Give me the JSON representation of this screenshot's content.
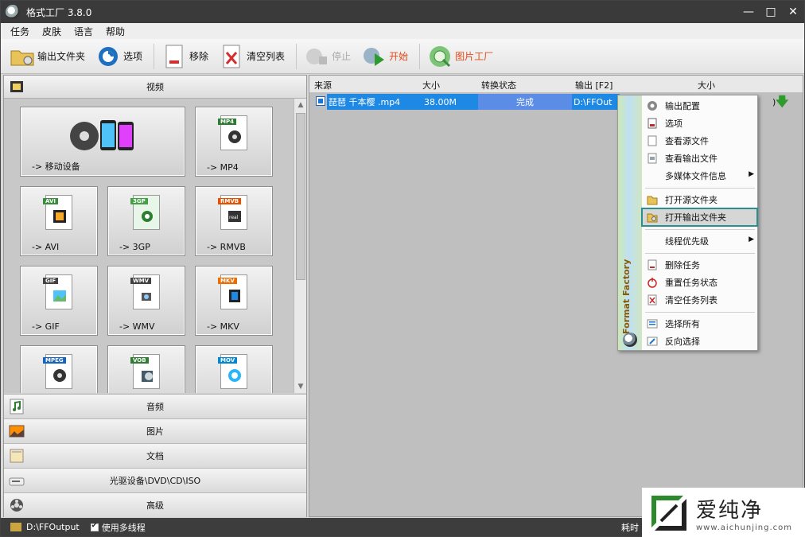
{
  "window": {
    "title": "格式工厂 3.8.0"
  },
  "menu": [
    "任务",
    "皮肤",
    "语言",
    "帮助"
  ],
  "toolbar": {
    "output_folder": "输出文件夹",
    "options": "选项",
    "remove": "移除",
    "clear_list": "清空列表",
    "stop": "停止",
    "start": "开始",
    "picture_factory": "图片工厂"
  },
  "left": {
    "video_header": "视频",
    "tiles": [
      "-> 移动设备",
      "-> MP4",
      "-> AVI",
      "-> 3GP",
      "-> RMVB",
      "-> GIF",
      "-> WMV",
      "-> MKV"
    ],
    "format_tags": [
      "MP4",
      "AVI",
      "3GP",
      "RMVB",
      "GIF",
      "WMV",
      "MKV",
      "MPEG",
      "VOB",
      "MOV"
    ],
    "categories": [
      "音频",
      "图片",
      "文档",
      "光驱设备\\DVD\\CD\\ISO",
      "高级"
    ]
  },
  "table": {
    "columns": [
      "来源",
      "大小",
      "转换状态",
      "输出 [F2]",
      "大小"
    ],
    "row": {
      "source": "琵琶 千本樱 .mp4",
      "size": "38.00M",
      "status": "完成",
      "output": "D:\\FFOut",
      "output_size_fragment": ")"
    }
  },
  "context_menu": {
    "brand": "Format Factory",
    "items": [
      "输出配置",
      "选项",
      "查看源文件",
      "查看输出文件",
      "多媒体文件信息",
      "打开源文件夹",
      "打开输出文件夹",
      "线程优先级",
      "删除任务",
      "重置任务状态",
      "清空任务列表",
      "选择所有",
      "反向选择"
    ]
  },
  "status": {
    "path": "D:\\FFOutput",
    "multithread": "使用多线程",
    "elapsed_label": "耗时"
  },
  "watermark": {
    "title": "爱纯净",
    "url": "www.aichunjing.com"
  },
  "colors": {
    "titlebar": "#3a3a3a",
    "selection": "#1e88e5",
    "status_done": "#5c8de6",
    "accent_text": "#e64a19",
    "highlight_border": "#2b8f8f"
  }
}
